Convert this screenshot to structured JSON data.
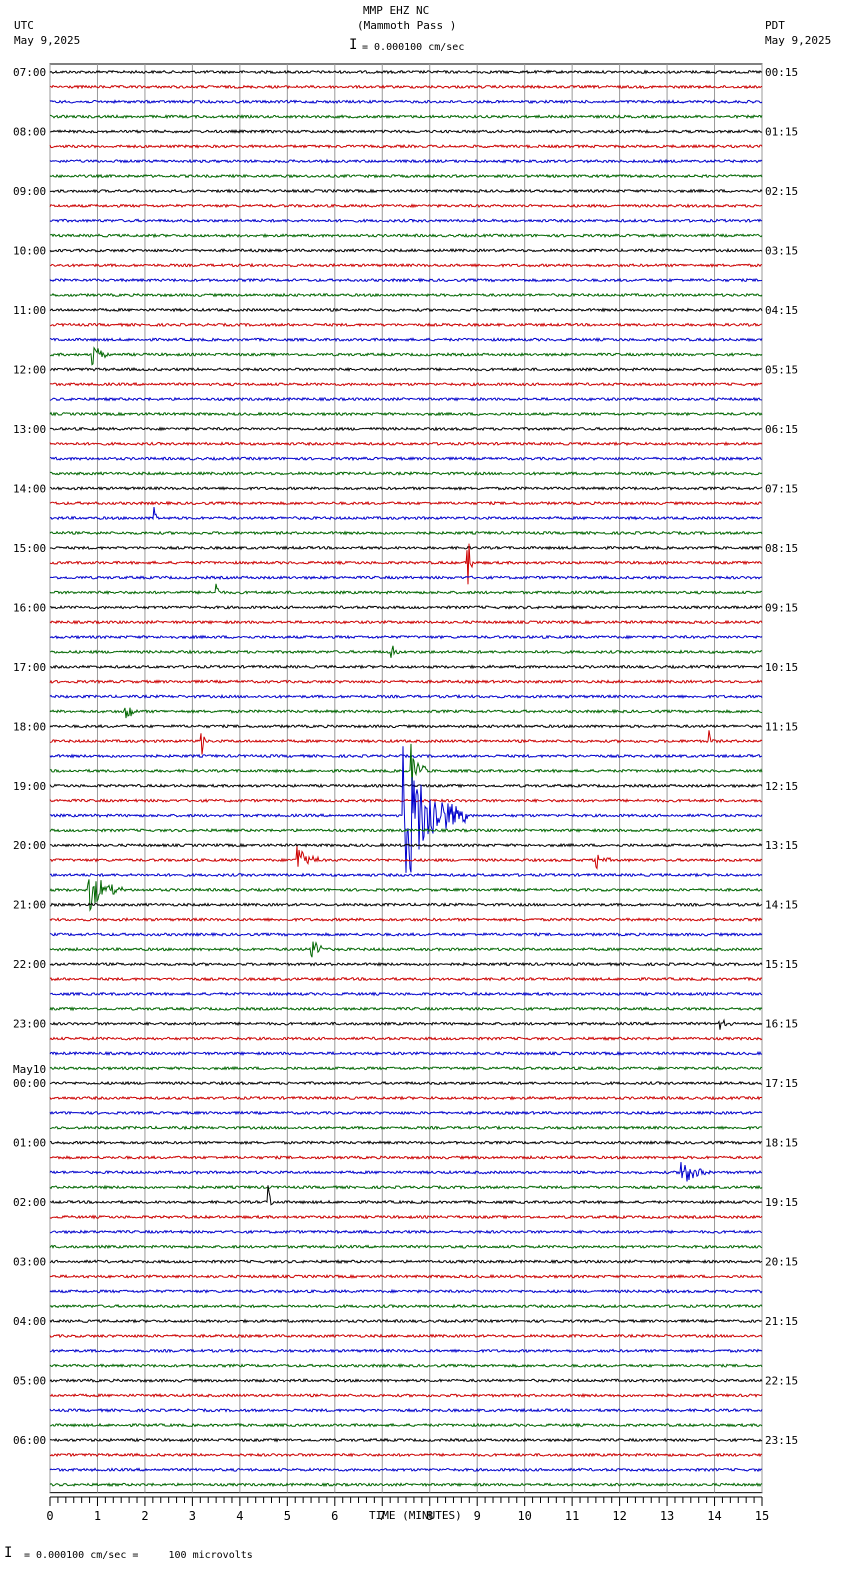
{
  "header": {
    "station": "MMP EHZ NC",
    "location": "(Mammoth Pass )",
    "scale": "= 0.000100 cm/sec",
    "left_tz": "UTC",
    "left_date": "May 9,2025",
    "right_tz": "PDT",
    "right_date": "May 9,2025"
  },
  "footer": {
    "scale_note": "= 0.000100 cm/sec =     100 microvolts"
  },
  "chart_data": {
    "type": "line",
    "title": "MMP EHZ NC (Mammoth Pass )",
    "xlabel": "TIME (MINUTES)",
    "xlim": [
      0,
      15
    ],
    "x_ticks": [
      "0",
      "1",
      "2",
      "3",
      "4",
      "5",
      "6",
      "7",
      "8",
      "9",
      "10",
      "11",
      "12",
      "13",
      "14",
      "15"
    ],
    "traces_per_hour": 4,
    "trace_count": 96,
    "trace_colors": [
      "#000000",
      "#cc0000",
      "#0000cc",
      "#006600"
    ],
    "left_labels": [
      "07:00",
      "08:00",
      "09:00",
      "10:00",
      "11:00",
      "12:00",
      "13:00",
      "14:00",
      "15:00",
      "16:00",
      "17:00",
      "18:00",
      "19:00",
      "20:00",
      "21:00",
      "22:00",
      "23:00",
      "00:00",
      "01:00",
      "02:00",
      "03:00",
      "04:00",
      "05:00",
      "06:00"
    ],
    "day_change_label": "May10",
    "right_labels": [
      "00:15",
      "01:15",
      "02:15",
      "03:15",
      "04:15",
      "05:15",
      "06:15",
      "07:15",
      "08:15",
      "09:15",
      "10:15",
      "11:15",
      "12:15",
      "13:15",
      "14:15",
      "15:15",
      "16:15",
      "17:15",
      "18:15",
      "19:15",
      "20:15",
      "21:15",
      "22:15",
      "23:15"
    ],
    "events": [
      {
        "trace": 19,
        "minute": 0.9,
        "amp": 12,
        "dur": 0.4
      },
      {
        "trace": 50,
        "minute": 7.45,
        "amp": 75,
        "dur": 1.3
      },
      {
        "trace": 53,
        "minute": 5.2,
        "amp": 20,
        "dur": 0.4
      },
      {
        "trace": 53,
        "minute": 11.5,
        "amp": 10,
        "dur": 0.3
      },
      {
        "trace": 55,
        "minute": 0.8,
        "amp": 25,
        "dur": 0.7
      },
      {
        "trace": 33,
        "minute": 8.8,
        "amp": 40,
        "dur": 0.05
      },
      {
        "trace": 35,
        "minute": 3.5,
        "amp": 12,
        "dur": 0.05
      },
      {
        "trace": 43,
        "minute": 1.6,
        "amp": 15,
        "dur": 0.2
      },
      {
        "trace": 45,
        "minute": 3.2,
        "amp": 18,
        "dur": 0.05
      },
      {
        "trace": 47,
        "minute": 7.6,
        "amp": 30,
        "dur": 0.3
      },
      {
        "trace": 39,
        "minute": 7.2,
        "amp": 10,
        "dur": 0.1
      },
      {
        "trace": 59,
        "minute": 5.5,
        "amp": 14,
        "dur": 0.3
      },
      {
        "trace": 64,
        "minute": 14.1,
        "amp": 8,
        "dur": 0.2
      },
      {
        "trace": 74,
        "minute": 13.3,
        "amp": 15,
        "dur": 0.6
      },
      {
        "trace": 76,
        "minute": 4.6,
        "amp": 18,
        "dur": 0.05
      },
      {
        "trace": 30,
        "minute": 2.2,
        "amp": 14,
        "dur": 0.05
      },
      {
        "trace": 45,
        "minute": 13.9,
        "amp": 14,
        "dur": 0.05
      }
    ]
  }
}
